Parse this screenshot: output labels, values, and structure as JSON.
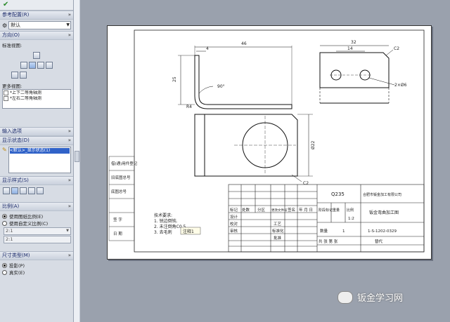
{
  "sidebar": {
    "sections": {
      "ref_config": {
        "label": "参考配置(R)",
        "value": "默认"
      },
      "direction": {
        "label": "方向(O)",
        "std_views_label": "标准视图:",
        "more_views_label": "更多视图:",
        "more_views": [
          "*上下二等角轴测",
          "*左右二等角轴测"
        ]
      },
      "import_options": {
        "label": "输入选项"
      },
      "display_state": {
        "label": "显示状态(D)",
        "selected": "<默认>_显示状态(1)"
      },
      "display_style": {
        "label": "显示样式(S)"
      },
      "scale": {
        "label": "比例(A)",
        "options": [
          "使用图纸比例(E)",
          "使用自定义比例(C)"
        ],
        "field1": "2:1",
        "field2": "2:1"
      },
      "dimension_type": {
        "label": "尺寸类型(M)",
        "options": [
          "投影(P)",
          "真实(E)"
        ]
      }
    }
  },
  "drawing": {
    "dims": {
      "top_width": "46",
      "left_small": "4",
      "height_25": "25",
      "r4": "R4",
      "angle": "90°",
      "right_width": "32",
      "right_inner": "14",
      "chamfer_c2": "C2",
      "hole": "2×Ø6",
      "circle_dia": "Ø22",
      "chamfer_bottom": "C2"
    },
    "left_strip": [
      "借(通)用件登记",
      "旧底图总号",
      "底图总号",
      "签  字",
      "日  期"
    ],
    "notes": [
      "技术要求:",
      "1. 锐边倒钝.",
      "2. 未注倒角C0.5",
      "3. 去毛刺"
    ],
    "tooltip": "注释1",
    "title_block": {
      "material": "Q235",
      "company": "合肥市钣金加工有限公司",
      "part_name": "钣金弯曲加工图",
      "scale": "1:2",
      "quantity_label": "数量",
      "quantity": "1",
      "drawing_no": "1-S-1202-0329",
      "header_row": [
        "标记",
        "处数",
        "分区",
        "更改文件号",
        "签名",
        "年 月 日"
      ],
      "row_labels": [
        "设计",
        "校对",
        "审核",
        "工艺",
        "标准化",
        "批准"
      ],
      "right_labels": [
        "阶段标记",
        "重量",
        "比例"
      ],
      "sheet_text": "共 张  第 张",
      "footer": "替代"
    }
  },
  "watermark": {
    "text": "钣金学习网"
  },
  "colors": {
    "sidebar_bg": "#d7dce4",
    "canvas_bg": "#9aa1ad",
    "selection": "#3062c8",
    "header_text": "#1b2a6a"
  }
}
